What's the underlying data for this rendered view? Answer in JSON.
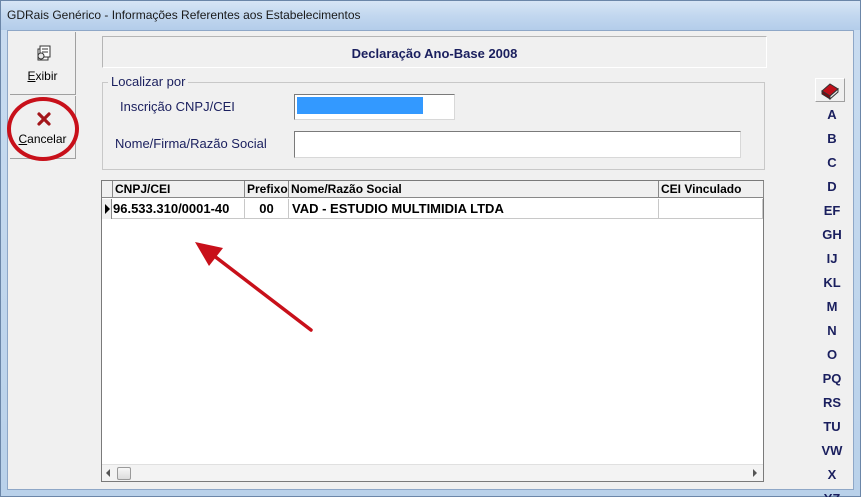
{
  "window": {
    "title": "GDRais Genérico - Informações Referentes aos Estabelecimentos"
  },
  "toolbar": {
    "exibir_label": "Exibir",
    "cancelar_label": "Cancelar"
  },
  "header": {
    "title": "Declaração Ano-Base 2008"
  },
  "search": {
    "legend": "Localizar por",
    "cnpj_label": "Inscrição CNPJ/CEI",
    "cnpj_value": "",
    "name_label": "Nome/Firma/Razão Social",
    "name_value": ""
  },
  "grid": {
    "columns": [
      "CNPJ/CEI",
      "Prefixo",
      "Nome/Razão Social",
      "CEI Vinculado"
    ],
    "rows": [
      {
        "cnpj": "96.533.310/0001-40",
        "prefixo": "00",
        "nome": "VAD - ESTUDIO MULTIMIDIA LTDA",
        "cei": ""
      }
    ]
  },
  "alphabet": [
    "A",
    "B",
    "C",
    "D",
    "EF",
    "GH",
    "IJ",
    "KL",
    "M",
    "N",
    "O",
    "PQ",
    "RS",
    "TU",
    "VW",
    "X",
    "YZ"
  ],
  "colors": {
    "annotation": "#c8101a",
    "selection": "#3399ff",
    "label": "#1a1f5e"
  }
}
